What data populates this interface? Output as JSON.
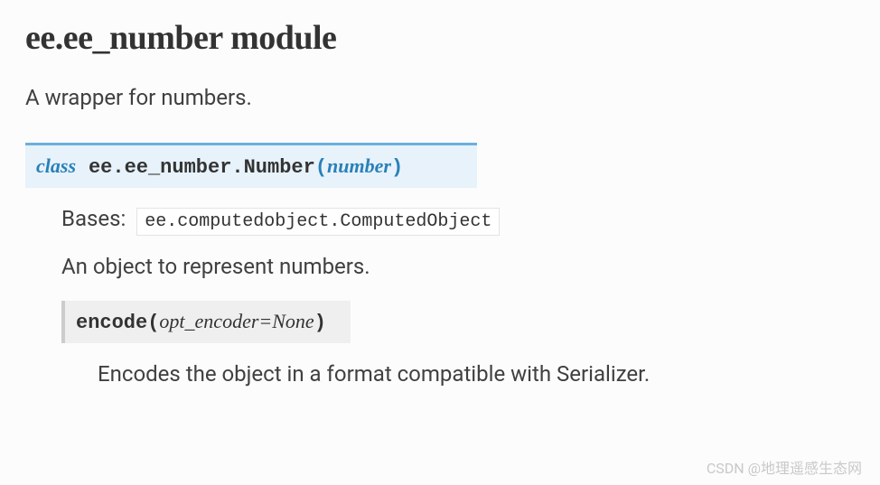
{
  "page": {
    "title": "ee.ee_number module",
    "description": "A wrapper for numbers."
  },
  "class": {
    "keyword": "class",
    "module_path": "ee.ee_number.",
    "name": "Number",
    "param": "number",
    "bases_label": "Bases:",
    "bases_value": "ee.computedobject.ComputedObject",
    "description": "An object to represent numbers."
  },
  "method": {
    "name": "encode",
    "params": "opt_encoder=None",
    "description": "Encodes the object in a format compatible with Serializer."
  },
  "watermark": "CSDN @地理遥感生态网"
}
